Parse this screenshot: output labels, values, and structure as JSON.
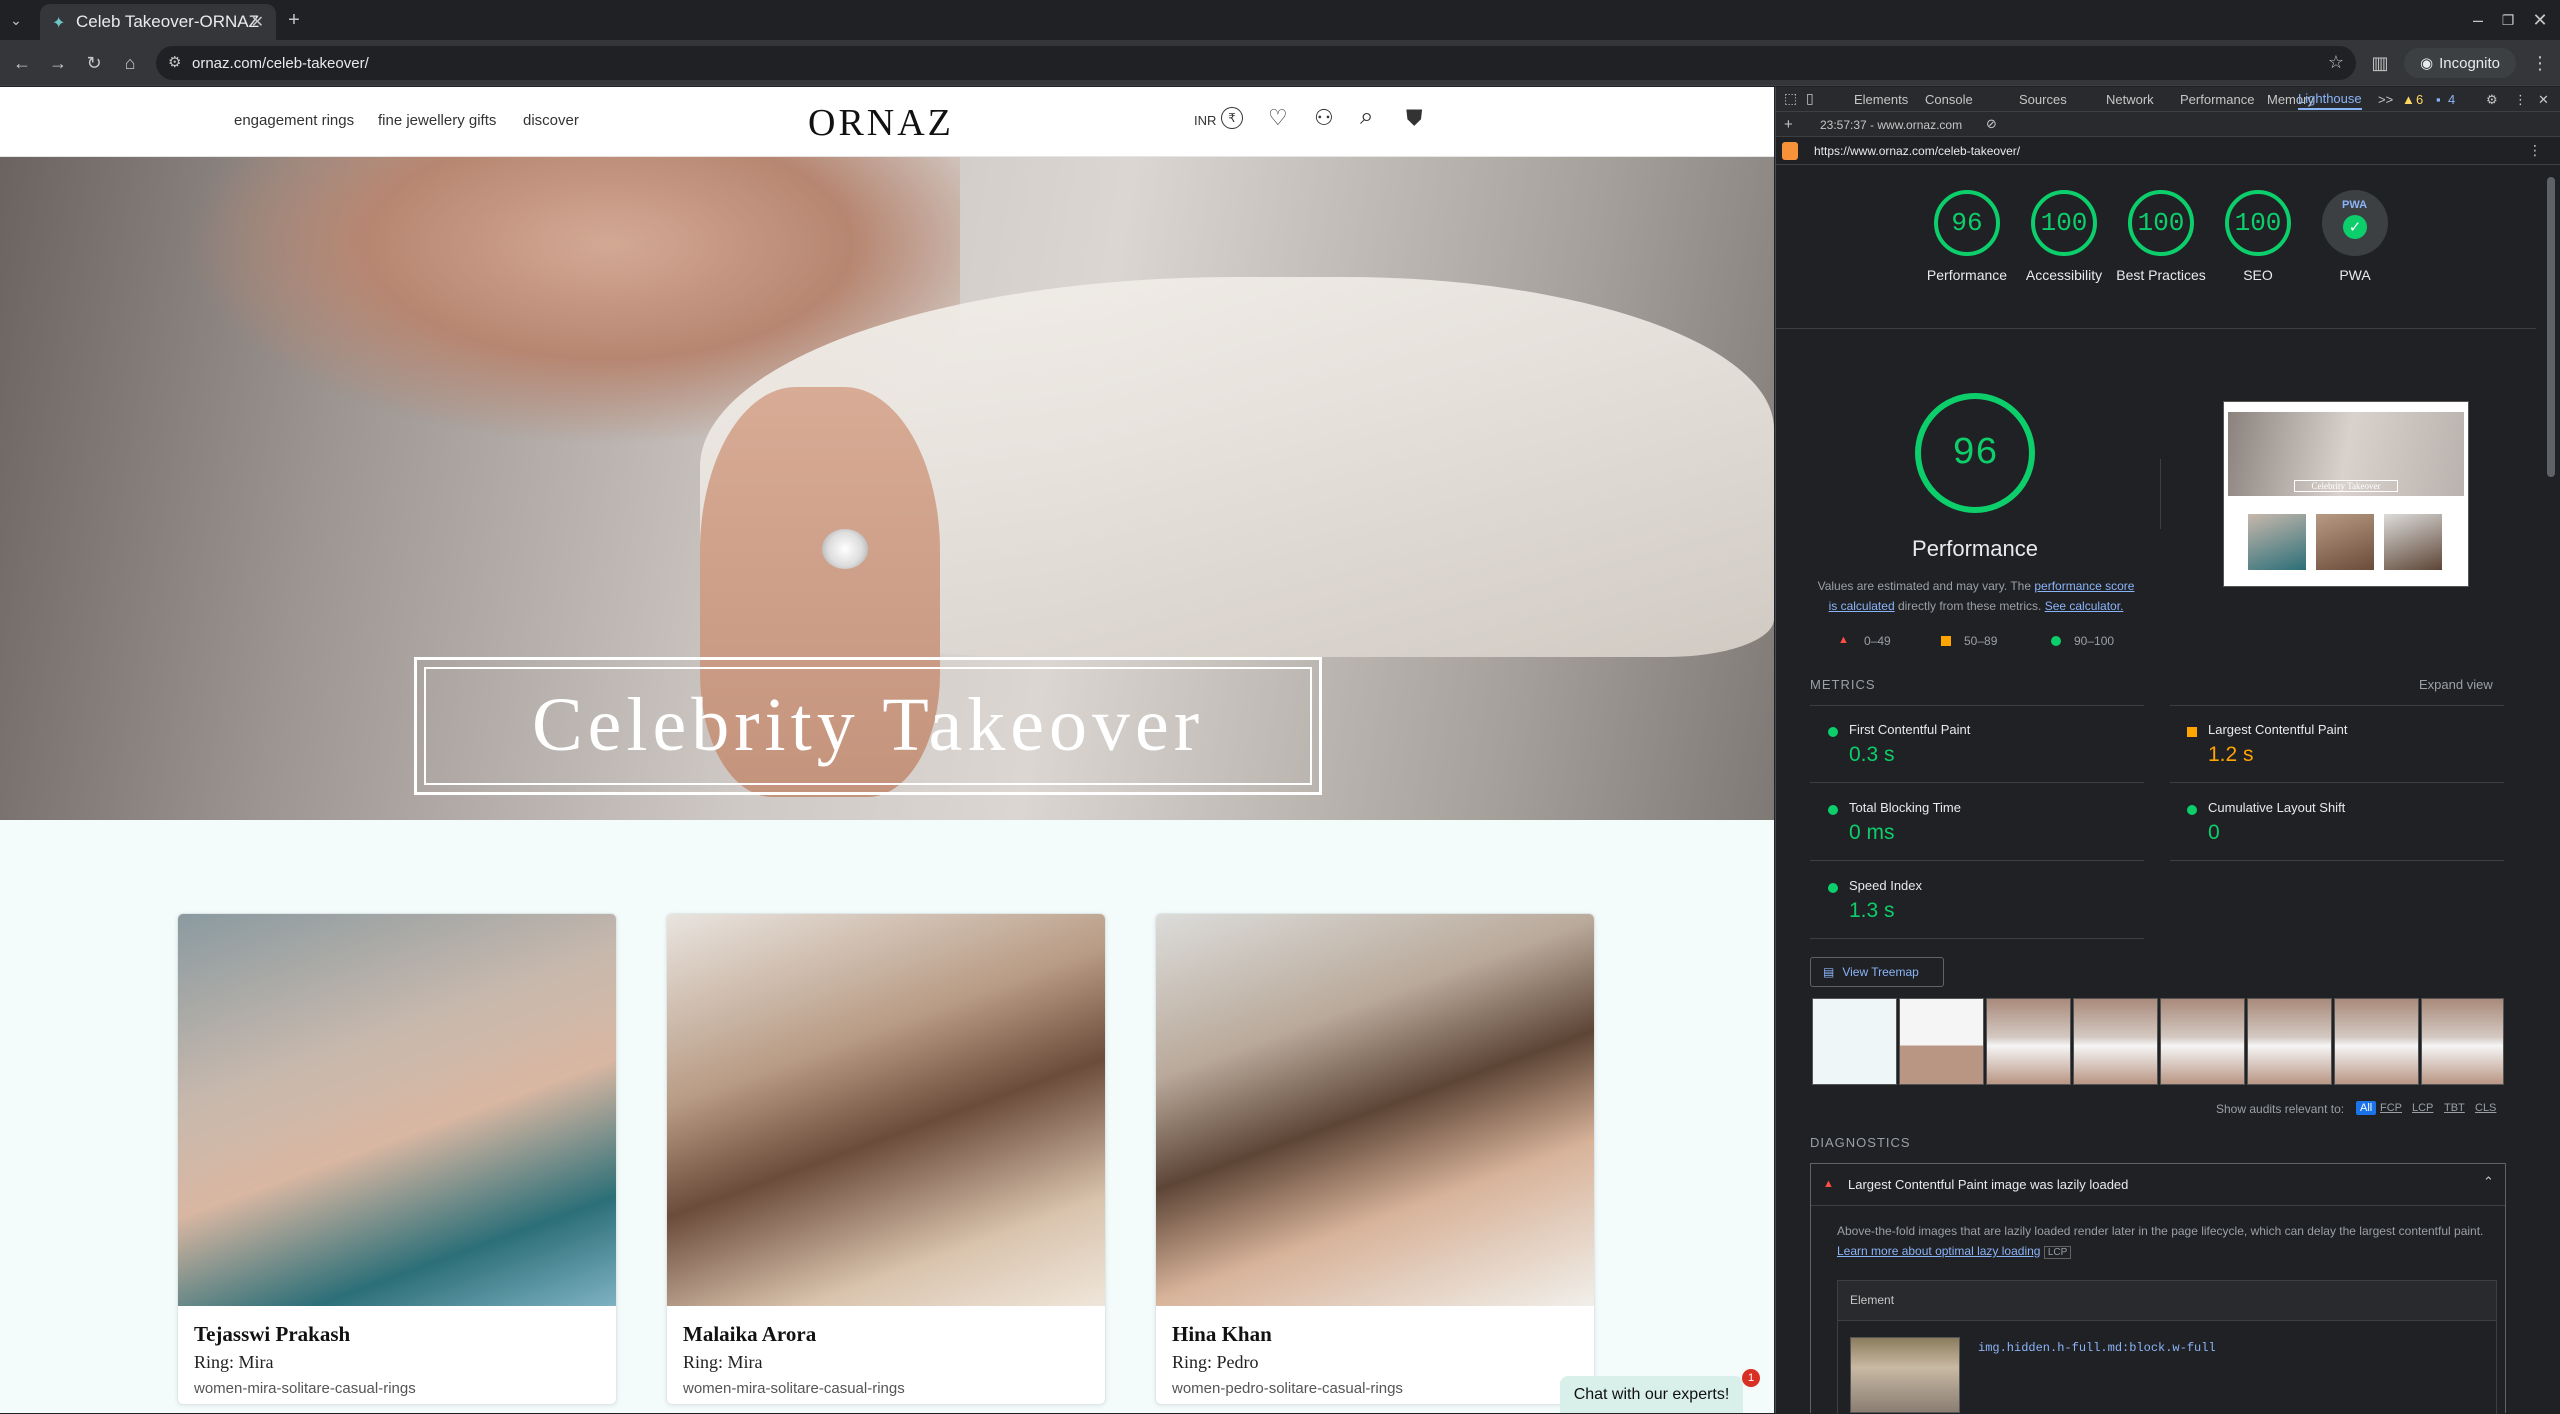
{
  "browser": {
    "tab_title": "Celeb Takeover-ORNAZ",
    "url": "ornaz.com/celeb-takeover/",
    "profile": "Incognito",
    "new_tab": "+"
  },
  "site": {
    "nav": [
      "engagement rings",
      "fine jewellery gifts",
      "discover"
    ],
    "logo": "ORNAZ",
    "currency": "INR",
    "currency_symbol": "₹",
    "hero_title": "Celebrity Takeover",
    "cards": [
      {
        "name": "Tejasswi Prakash",
        "ring": "Ring: Mira",
        "slug": "women-mira-solitare-casual-rings"
      },
      {
        "name": "Malaika Arora",
        "ring": "Ring: Mira",
        "slug": "women-mira-solitare-casual-rings"
      },
      {
        "name": "Hina Khan",
        "ring": "Ring: Pedro",
        "slug": "women-pedro-solitare-casual-rings"
      }
    ],
    "chat_label": "Chat with our experts!",
    "chat_badge": "1"
  },
  "devtools": {
    "tabs": [
      "Elements",
      "Console",
      "Sources",
      "Network",
      "Performance",
      "Memory",
      "Lighthouse"
    ],
    "more": ">>",
    "warn_count": "6",
    "msg_count": "4",
    "report_time": "23:57:37 - www.ornaz.com",
    "report_url": "https://www.ornaz.com/celeb-takeover/",
    "categories": [
      {
        "score": "96",
        "label": "Performance"
      },
      {
        "score": "100",
        "label": "Accessibility"
      },
      {
        "score": "100",
        "label": "Best Practices"
      },
      {
        "score": "100",
        "label": "SEO"
      },
      {
        "score": "",
        "label": "PWA"
      }
    ],
    "pwa_text": "PWA",
    "perf_score": "96",
    "perf_title": "Performance",
    "perf_note_1": "Values are estimated and may vary. The",
    "perf_note_link": "performance score is calculated",
    "perf_note_2": "directly from these metrics.",
    "perf_note_link2": "See calculator.",
    "legend": [
      "0–49",
      "50–89",
      "90–100"
    ],
    "metrics_title": "METRICS",
    "expand_view": "Expand view",
    "metrics": [
      {
        "name": "First Contentful Paint",
        "value": "0.3 s",
        "status": "pass"
      },
      {
        "name": "Largest Contentful Paint",
        "value": "1.2 s",
        "status": "average"
      },
      {
        "name": "Total Blocking Time",
        "value": "0 ms",
        "status": "pass"
      },
      {
        "name": "Cumulative Layout Shift",
        "value": "0",
        "status": "pass"
      },
      {
        "name": "Speed Index",
        "value": "1.3 s",
        "status": "pass"
      }
    ],
    "view_treemap": "View Treemap",
    "show_audits": "Show audits relevant to:",
    "audit_filters": [
      "All",
      "FCP",
      "LCP",
      "TBT",
      "CLS"
    ],
    "diagnostics_title": "DIAGNOSTICS",
    "diag_item": "Largest Contentful Paint image was lazily loaded",
    "diag_desc": "Above-the-fold images that are lazily loaded render later in the page lifecycle, which can delay the largest contentful paint.",
    "diag_link": "Learn more about optimal lazy loading",
    "diag_tag": "LCP",
    "element_header": "Element",
    "element_selector": "img.hidden.h-full.md:block.w-full",
    "screenshot_title": "Celebrity Takeover",
    "colors": {
      "pass": "#0cce6b",
      "average": "#ffa400",
      "fail": "#ff4e42",
      "accent": "#8ab4f8"
    }
  }
}
